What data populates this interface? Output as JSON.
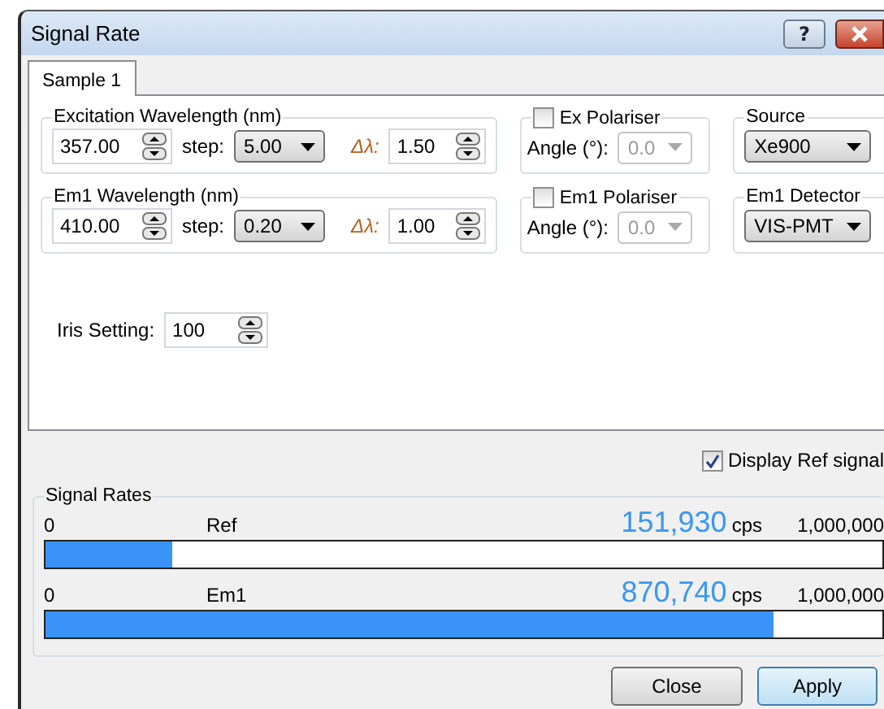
{
  "window": {
    "title": "Signal Rate",
    "help": "?"
  },
  "tabs": [
    {
      "label": "Sample 1",
      "selected": true
    }
  ],
  "rows": [
    {
      "legend": "Excitation Wavelength (nm)",
      "value": "357.00",
      "step_label": "step:",
      "step": "5.00",
      "delta_label": "Δλ:",
      "delta": "1.50",
      "polariser": {
        "label": "Ex Polariser",
        "checked": false,
        "angle_label": "Angle (°):",
        "angle": "0.0",
        "disabled": true
      },
      "selector": {
        "legend": "Source",
        "value": "Xe900"
      }
    },
    {
      "legend": "Em1 Wavelength (nm)",
      "value": "410.00",
      "step_label": "step:",
      "step": "0.20",
      "delta_label": "Δλ:",
      "delta": "1.00",
      "polariser": {
        "label": "Em1 Polariser",
        "checked": false,
        "angle_label": "Angle (°):",
        "angle": "0.0",
        "disabled": true
      },
      "selector": {
        "legend": "Em1 Detector",
        "value": "VIS-PMT"
      }
    }
  ],
  "iris": {
    "label": "Iris Setting:",
    "value": "100"
  },
  "display_ref": {
    "label": "Display Ref signal",
    "checked": true
  },
  "signal_rates": {
    "legend": "Signal Rates",
    "rows": [
      {
        "min": "0",
        "name": "Ref",
        "reading": "151,930",
        "unit": "cps",
        "max": "1,000,000",
        "level": 0.152
      },
      {
        "min": "0",
        "name": "Em1",
        "reading": "870,740",
        "unit": "cps",
        "max": "1,000,000",
        "level": 0.87
      }
    ]
  },
  "buttons": [
    {
      "label": "Close",
      "default": false
    },
    {
      "label": "Apply",
      "default": true
    }
  ]
}
